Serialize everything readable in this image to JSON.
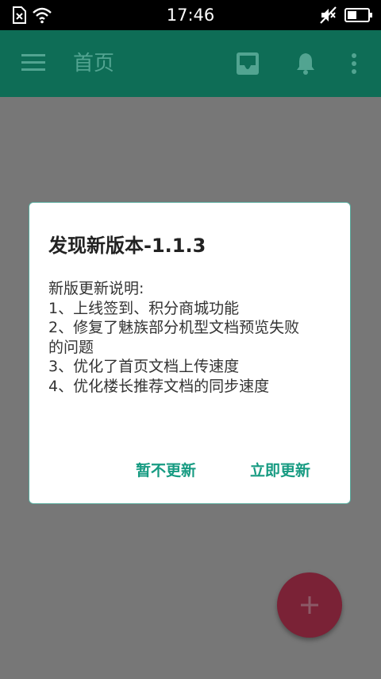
{
  "status_bar": {
    "time": "17:46",
    "icons": [
      "sim-missing-icon",
      "wifi-icon",
      "mute-icon",
      "battery-icon"
    ]
  },
  "app_bar": {
    "title": "首页",
    "icons": [
      "menu-icon",
      "inbox-icon",
      "bell-icon",
      "more-vert-icon"
    ],
    "color": "#0e6d56"
  },
  "dialog": {
    "title": "发现新版本-1.1.3",
    "lines": [
      "新版更新说明:",
      "1、上线签到、积分商城功能",
      "2、修复了魅族部分机型文档预览失败",
      "的问题",
      "3、优化了首页文档上传速度",
      "4、优化楼长推荐文档的同步速度"
    ],
    "negative_button": "暂不更新",
    "positive_button": "立即更新",
    "accent_color": "#179b82"
  },
  "fab": {
    "icon": "plus-icon",
    "color": "#7a2236"
  }
}
